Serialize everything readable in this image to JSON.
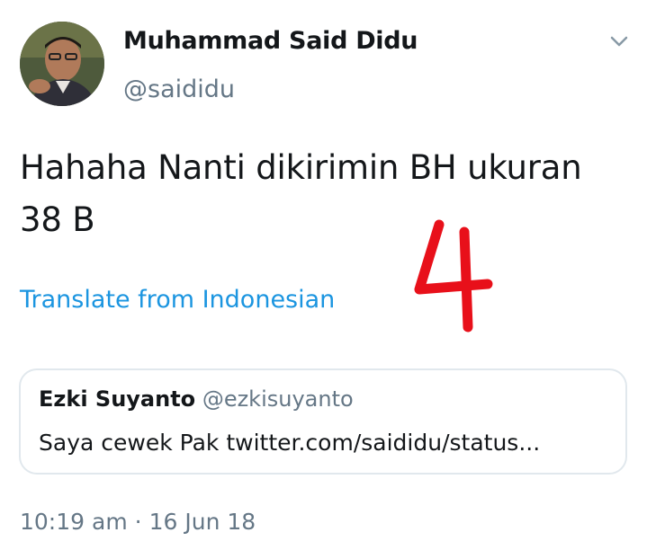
{
  "author": {
    "name": "Muhammad Said Didu",
    "handle": "@saididu"
  },
  "tweet": {
    "text": "Hahaha Nanti dikirimin BH ukuran 38 B",
    "translate_label": "Translate from Indonesian"
  },
  "annotation": {
    "text": "4",
    "color": "#e8101a"
  },
  "quoted_tweet": {
    "name": "Ezki Suyanto",
    "handle": "@ezkisuyanto",
    "text": "Saya cewek Pak twitter.com/saididu/status..."
  },
  "meta": {
    "time": "10:19 am",
    "separator": "·",
    "date": "16 Jun 18"
  },
  "icons": {
    "menu": "chevron-down-icon",
    "avatar": "profile-photo"
  },
  "colors": {
    "text": "#14171a",
    "secondary": "#657786",
    "link": "#1b95e0",
    "border": "#e1e8ed"
  }
}
